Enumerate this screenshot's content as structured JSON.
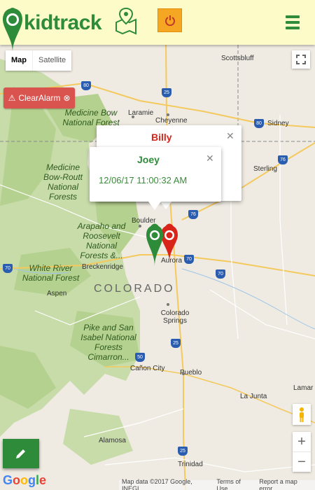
{
  "header": {
    "brand": "kidtrack",
    "icons": {
      "logo": "kid-location-pin-icon",
      "map": "map-pin-icon",
      "power": "power-icon",
      "menu": "hamburger-menu-icon"
    },
    "brand_color": "#2e8b3a",
    "power_color": "#f5a623"
  },
  "map_controls": {
    "map_label": "Map",
    "satellite_label": "Satellite",
    "clear_alarm_label": "ClearAlarm"
  },
  "map_labels": {
    "state": "COLORADO",
    "forests": [
      "Medicine Bow National Forest",
      "Medicine Bow-Routt National Forests",
      "Arapaho and Roosevelt National Forests &...",
      "White River National Forest",
      "Pike and San Isabel National Forests Cimarron..."
    ],
    "cities": [
      "Laramie",
      "Cheyenne",
      "Scottsbluff",
      "Sidney",
      "Sterling",
      "Boulder",
      "Aurora",
      "Breckenridge",
      "Aspen",
      "Colorado Springs",
      "Cañon City",
      "Pueblo",
      "La Junta",
      "Alamosa",
      "Trinidad",
      "Lamar"
    ],
    "highways": [
      "80",
      "25",
      "80",
      "76",
      "76",
      "70",
      "70",
      "70",
      "25",
      "25",
      "50"
    ]
  },
  "info_windows": {
    "billy": {
      "name": "Billy",
      "color": "#d9241a"
    },
    "joey": {
      "name": "Joey",
      "time": "12/06/17 11:00:32 AM",
      "color": "#2e8b3a"
    }
  },
  "footer": {
    "google": "Google",
    "map_data": "Map data ©2017 Google, INEGI",
    "terms": "Terms of Use",
    "report": "Report a map error"
  }
}
